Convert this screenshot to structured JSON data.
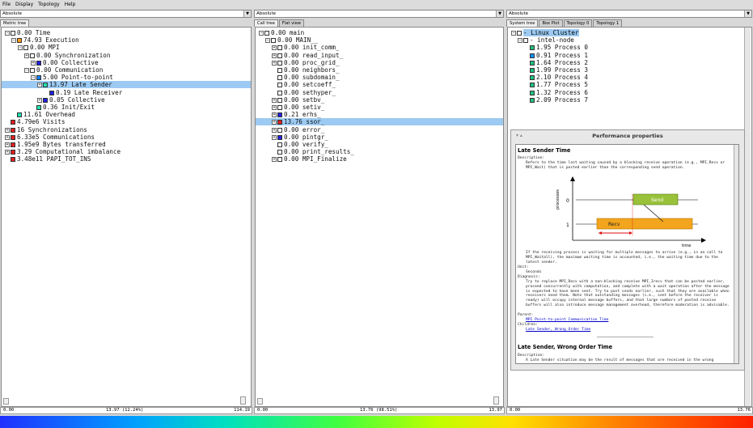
{
  "menu": [
    "File",
    "Display",
    "Topology",
    "Help"
  ],
  "panes": {
    "metric": {
      "combo": "Absolute",
      "tabs": [
        "Metric tree"
      ],
      "status_left": "0.00",
      "status_mid": "13.97 (12.24%)",
      "status_right": "114.19"
    },
    "call": {
      "combo": "Absolute",
      "tabs": [
        "Call tree",
        "Flat view"
      ],
      "status_left": "0.00",
      "status_mid": "13.76 (98.51%)",
      "status_right": "13.97"
    },
    "system": {
      "combo": "Absolute",
      "tabs": [
        "System tree",
        "Box Plot",
        "Topology 0",
        "Topology 1"
      ],
      "status_left": "0.00",
      "status_right": "13.76"
    }
  },
  "metric_tree": [
    {
      "exp": "-",
      "color": "#ffffff",
      "text": "0.00 Time"
    },
    {
      "exp": "-",
      "color": "#ff9a1a",
      "text": "74.93 Execution"
    },
    {
      "exp": "-",
      "color": "#ffffff",
      "text": "0.00 MPI"
    },
    {
      "exp": "+",
      "color": "#ffffff",
      "text": "0.00 Synchronization"
    },
    {
      "exp": "+",
      "color": "#2020e0",
      "text": "0.00 Collective"
    },
    {
      "exp": "-",
      "color": "#ffffff",
      "text": "0.00 Communication"
    },
    {
      "exp": "-",
      "color": "#1080ff",
      "text": "5.00 Point-to-point"
    },
    {
      "exp": "+",
      "color": "#20e0b0",
      "text": "13.97 Late Sender"
    },
    {
      "exp": "",
      "color": "#2020e0",
      "text": "0.19 Late Receiver"
    },
    {
      "exp": "+",
      "color": "#2020e0",
      "text": "0.05 Collective"
    },
    {
      "exp": "",
      "color": "#20e0b0",
      "text": "0.36 Init/Exit"
    },
    {
      "exp": "",
      "color": "#20e0b0",
      "text": "11.61 Overhead"
    },
    {
      "exp": "",
      "color": "#e02020",
      "text": "4.79e6 Visits"
    },
    {
      "exp": "+",
      "color": "#e02020",
      "text": "16 Synchronizations"
    },
    {
      "exp": "+",
      "color": "#e02020",
      "text": "6.33e5 Communications"
    },
    {
      "exp": "+",
      "color": "#e02020",
      "text": "1.95e9 Bytes transferred"
    },
    {
      "exp": "+",
      "color": "#e02020",
      "text": "3.29 Computational imbalance"
    },
    {
      "exp": "",
      "color": "#e02020",
      "text": "3.48e11 PAPI_TOT_INS"
    }
  ],
  "call_tree": [
    {
      "exp": "-",
      "color": "#ffffff",
      "text": "0.00 main"
    },
    {
      "exp": "-",
      "color": "#ffffff",
      "text": "0.00 MAIN__"
    },
    {
      "exp": "+",
      "color": "#ffffff",
      "text": "0.00 init_comm_"
    },
    {
      "exp": "+",
      "color": "#ffffff",
      "text": "0.00 read_input_"
    },
    {
      "exp": "+",
      "color": "#ffffff",
      "text": "0.00 proc_grid_"
    },
    {
      "exp": "",
      "color": "#ffffff",
      "text": "0.00 neighbors_"
    },
    {
      "exp": "",
      "color": "#ffffff",
      "text": "0.00 subdomain_"
    },
    {
      "exp": "",
      "color": "#ffffff",
      "text": "0.00 setcoeff_"
    },
    {
      "exp": "",
      "color": "#ffffff",
      "text": "0.00 sethyper_"
    },
    {
      "exp": "+",
      "color": "#ffffff",
      "text": "0.00 setbv_"
    },
    {
      "exp": "+",
      "color": "#ffffff",
      "text": "0.00 setiv_"
    },
    {
      "exp": "+",
      "color": "#2020e0",
      "text": "0.21 erhs_"
    },
    {
      "exp": "+",
      "color": "#e02020",
      "text": "13.76 ssor_"
    },
    {
      "exp": "+",
      "color": "#ffffff",
      "text": "0.00 error_"
    },
    {
      "exp": "+",
      "color": "#2020e0",
      "text": "0.00 pintgr_"
    },
    {
      "exp": "",
      "color": "#ffffff",
      "text": "0.00 verify_"
    },
    {
      "exp": "",
      "color": "#ffffff",
      "text": "0.00 print_results_"
    },
    {
      "exp": "+",
      "color": "#ffffff",
      "text": "0.00 MPI_Finalize"
    }
  ],
  "system_tree": [
    {
      "exp": "-",
      "color": "#ffffff",
      "text": "- Linux Cluster"
    },
    {
      "exp": "-",
      "color": "#ffffff",
      "text": "- intel-node"
    },
    {
      "exp": "",
      "color": "#20c080",
      "text": "1.95 Process 0"
    },
    {
      "exp": "",
      "color": "#1090ff",
      "text": "0.91 Process 1"
    },
    {
      "exp": "",
      "color": "#20c080",
      "text": "1.64 Process 2"
    },
    {
      "exp": "",
      "color": "#20c080",
      "text": "1.99 Process 3"
    },
    {
      "exp": "",
      "color": "#20c080",
      "text": "2.10 Process 4"
    },
    {
      "exp": "",
      "color": "#20c080",
      "text": "1.77 Process 5"
    },
    {
      "exp": "",
      "color": "#20c080",
      "text": "1.32 Process 6"
    },
    {
      "exp": "",
      "color": "#20c080",
      "text": "2.09 Process 7"
    }
  ],
  "popup": {
    "title": "Performance properties",
    "heading1": "Late Sender Time",
    "desc_label": "Description:",
    "desc": "Refers to the time lost waiting caused by a blocking receive operation (e.g., MPI_Recv or MPI_Wait) that is posted earlier than the corresponding send operation.",
    "diagram": {
      "ylabel": "processes",
      "p0": "0",
      "p1": "1",
      "send": "Send",
      "recv": "Recv",
      "time": "time"
    },
    "para2": "If the receiving process is waiting for multiple messages to arrive (e.g., in an call to MPI_Waitall), the maximum waiting time is accounted, i.e., the waiting time due to the latest sender.",
    "unit_label": "Unit:",
    "unit": "Seconds",
    "diag_label": "Diagnosis:",
    "diagnosis": "Try to replace MPI_Recv with a non-blocking receive MPI_Irecv that can be posted earlier, proceed concurrently with computation, and complete with a wait operation after the message is expected to have been sent. Try to post sends earlier, such that they are available when receivers need them. Note that outstanding messages (i.e., sent before the receiver is ready) will occupy internal message buffers, and that large numbers of posted receive buffers will also introduce message management overhead, therefore moderation is advisable.",
    "parent_label": "Parent:",
    "parent": "MPI Point-to-point Communication Time",
    "children_label": "Children:",
    "children": "Late Sender, Wrong Order Time",
    "heading2": "Late Sender, Wrong Order Time",
    "desc2_label": "Description:",
    "desc2": "A Late Sender situation may be the result of messages that are received in the wrong"
  }
}
